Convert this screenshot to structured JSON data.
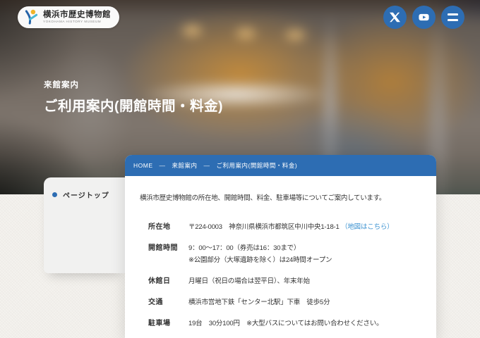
{
  "brand": {
    "title": "横浜市歴史博物館",
    "subtitle": "YOKOHAMA HISTORY MUSEUM"
  },
  "hero": {
    "category": "来館案内",
    "title": "ご利用案内(開館時間・料金)"
  },
  "breadcrumb": {
    "separator": "—",
    "items": [
      {
        "label": "HOME"
      },
      {
        "label": "来館案内"
      },
      {
        "label": "ご利用案内(開館時間・料金)"
      }
    ]
  },
  "sidebar": {
    "items": [
      {
        "label": "ページトップ"
      }
    ]
  },
  "content": {
    "intro": "横浜市歴史博物館の所在地、開館時間、料金、駐車場等についてご案内しています。",
    "rows": [
      {
        "label": "所在地",
        "text": "〒224-0003　神奈川県横浜市都筑区中川中央1-18-1",
        "link": "（地図はこちら）"
      },
      {
        "label": "開館時間",
        "lines": [
          "9：00〜17：00（券売は16：30まで）",
          "※公園部分（大塚遺跡を除く）は24時間オープン"
        ]
      },
      {
        "label": "休館日",
        "lines": [
          "月曜日（祝日の場合は翌平日）、年末年始"
        ]
      },
      {
        "label": "交通",
        "lines": [
          "横浜市営地下鉄「センター北駅」下車　徒歩5分"
        ]
      },
      {
        "label": "駐車場",
        "lines": [
          "19台　30分100円　※大型バスについてはお問い合わせください。"
        ]
      }
    ]
  },
  "colors": {
    "accent_blue": "#2d6db3",
    "link_blue": "#3d93d1",
    "text": "#333333",
    "card_bg": "#ffffff",
    "sidebar_bg": "#f1f1f0",
    "page_bg": "#f4f2ee"
  }
}
